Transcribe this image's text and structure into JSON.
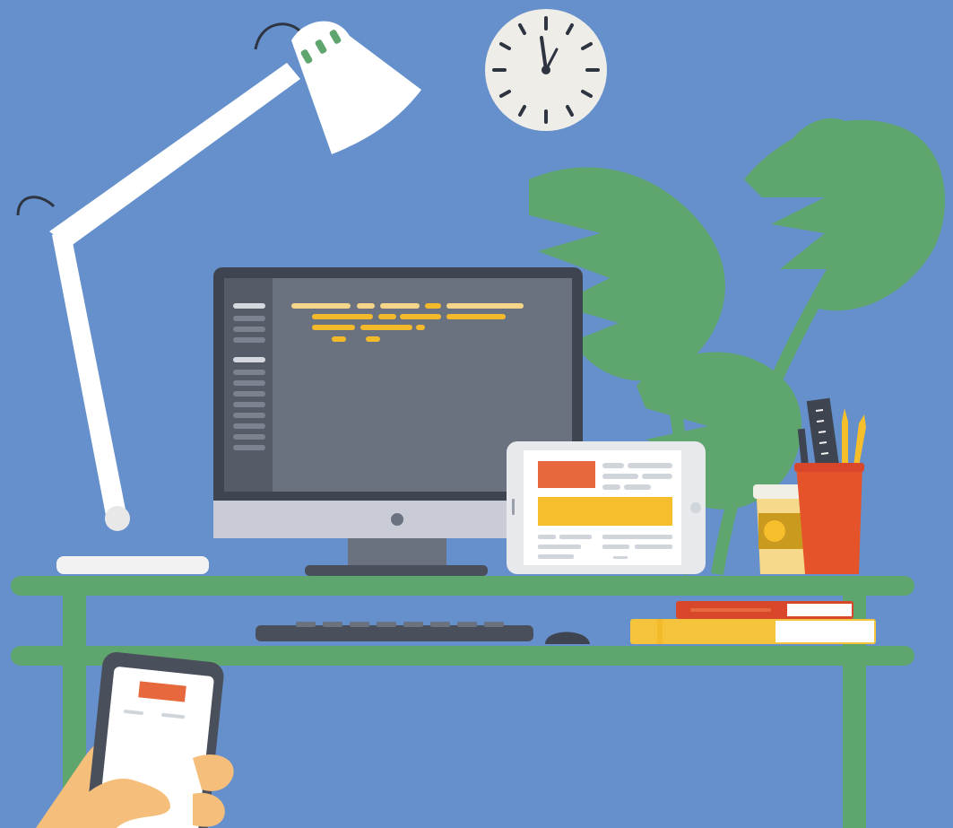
{
  "scene": {
    "description_free": true,
    "colors": {
      "background": "#6590CC",
      "plant": "#5FA56E",
      "desk": "#5FA56E",
      "lamp": "#FFFFFF",
      "lamp_accent": "#5FA56E",
      "monitor_frame": "#3E4450",
      "monitor_screen": "#6A7280",
      "monitor_sidebar": "#555C68",
      "monitor_chin": "#C9CCD4",
      "code_light": "#F4D58A",
      "code_dark": "#F2B92A",
      "tablet_orange": "#E8683D",
      "tablet_yellow": "#F6BE2A",
      "cup": "#F6BE2A",
      "pencil_holder": "#E4532A",
      "books_red": "#D9472B",
      "books_yellow": "#F6C33C",
      "keyboard": "#4A4F5C",
      "hand": "#F6BE7B",
      "phone_frame": "#4A4F5C"
    },
    "icons": [
      "desk-lamp-icon",
      "wall-clock-icon",
      "desktop-monitor-icon",
      "tablet-icon",
      "coffee-cup-icon",
      "pencil-holder-icon",
      "books-icon",
      "keyboard-icon",
      "mouse-icon",
      "smartphone-icon",
      "monstera-plant-icon"
    ],
    "clock": {
      "hour": 12,
      "minute": 0
    }
  }
}
